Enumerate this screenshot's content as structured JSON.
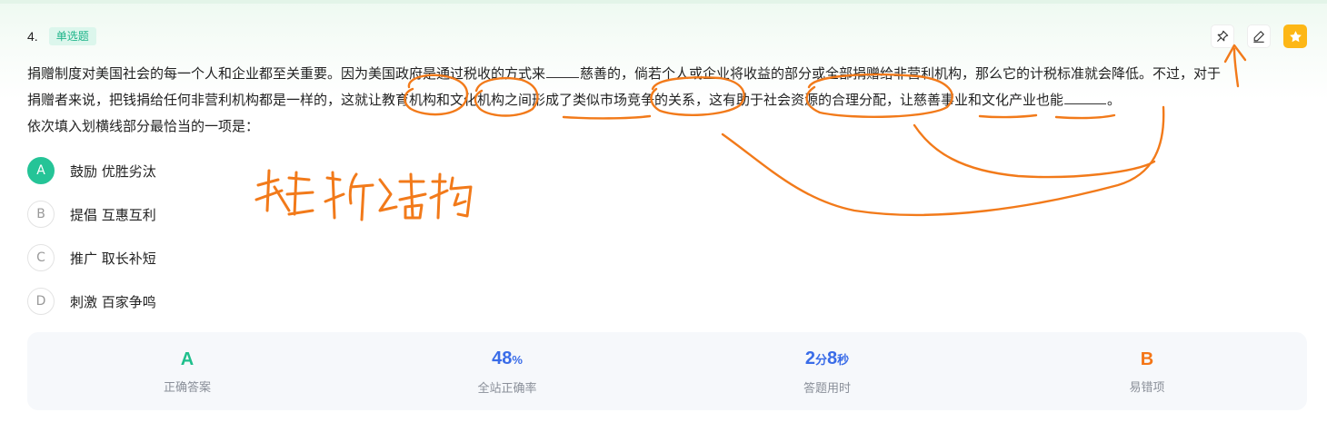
{
  "question": {
    "number": "4.",
    "type_badge": "单选题",
    "stem_line1_a": "捐赠制度对美国社会的每一个人和企业都至关重要。因为美国政府是通过税收的方式来",
    "stem_line1_b": "慈善的，倘若个人或企业将收益的部分或全部捐赠给非营利机构，那么它的计税标准就会降低。不过，对于",
    "stem_line2_a": "捐赠者来说，把钱捐给任何非营利机构都是一样的，这就让教育机构和文化机构之间形成了类似市场竞争的关系，这有助于社会资源的合理分配，让慈善事业和文化产业也能",
    "stem_line2_b": "。",
    "prompt": "依次填入划横线部分最恰当的一项是："
  },
  "options": [
    {
      "letter": "A",
      "text": "鼓励 优胜劣汰",
      "correct": true
    },
    {
      "letter": "B",
      "text": "提倡 互惠互利",
      "correct": false
    },
    {
      "letter": "C",
      "text": "推广 取长补短",
      "correct": false
    },
    {
      "letter": "D",
      "text": "刺激 百家争鸣",
      "correct": false
    }
  ],
  "stats": {
    "correct_answer": {
      "value": "A",
      "label": "正确答案"
    },
    "accuracy": {
      "value": "48",
      "unit": "%",
      "label": "全站正确率"
    },
    "time": {
      "min": "2",
      "min_unit": "分",
      "sec": "8",
      "sec_unit": "秒",
      "label": "答题用时"
    },
    "common_wrong": {
      "value": "B",
      "label": "易错项"
    }
  },
  "tools": [
    "pin-icon",
    "edit-icon",
    "star-icon"
  ],
  "colors": {
    "accent_green": "#25c497",
    "accuracy_blue": "#3a6ce8",
    "wrong_orange": "#f47516",
    "annotation_orange": "#f27a1a",
    "favorite_yellow": "#fdb716"
  }
}
